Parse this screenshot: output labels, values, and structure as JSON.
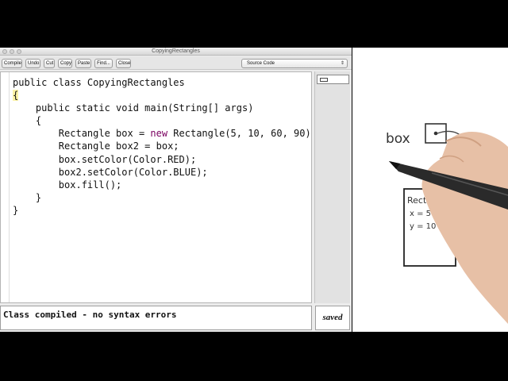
{
  "window": {
    "title": "CopyingRectangles"
  },
  "toolbar": {
    "buttons": [
      "Compile",
      "Undo",
      "Cut",
      "Copy",
      "Paste",
      "Find...",
      "Close"
    ],
    "view_select": "Source Code"
  },
  "editor": {
    "lines": [
      [
        {
          "t": "public class CopyingRectangles"
        }
      ],
      [
        {
          "t": "{",
          "c": "brace"
        }
      ],
      [
        {
          "t": "    public static void main(String[] args)"
        }
      ],
      [
        {
          "t": "    {"
        }
      ],
      [
        {
          "t": "        Rectangle box = "
        },
        {
          "t": "new",
          "c": "kw"
        },
        {
          "t": " Rectangle(5, 10, 60, 90);"
        }
      ],
      [
        {
          "t": "        Rectangle box2 = box;"
        }
      ],
      [
        {
          "t": "        box.setColor(Color.RED);"
        }
      ],
      [
        {
          "t": "        box2.setColor(Color.BLUE);"
        }
      ],
      [
        {
          "t": "        box.fill();"
        }
      ],
      [
        {
          "t": "    }"
        }
      ],
      [
        {
          "t": "}"
        }
      ]
    ]
  },
  "status": {
    "message": "Class compiled - no syntax errors",
    "saved_label": "saved"
  },
  "whiteboard": {
    "variable_label": "box",
    "object_title": "Rectang",
    "field_x": "x = 5",
    "field_y": "y = 10"
  },
  "colors": {
    "keyword": "#7a0060",
    "brace_highlight": "#fbf3a8",
    "background": "#000000"
  }
}
